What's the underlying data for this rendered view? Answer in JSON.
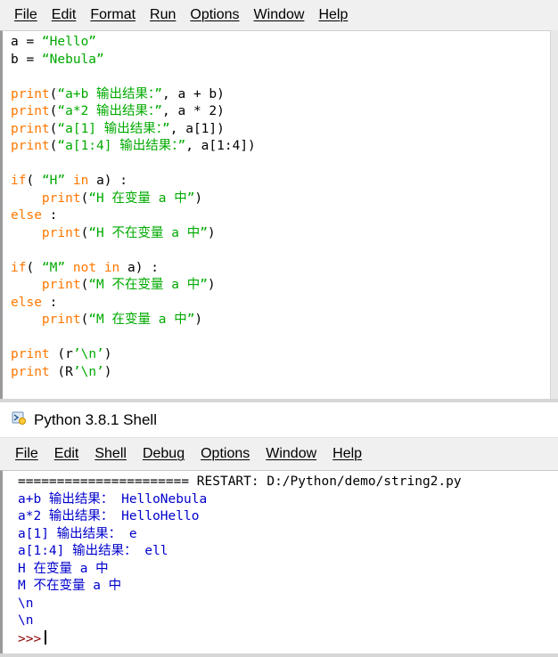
{
  "editor": {
    "menu": [
      "File",
      "Edit",
      "Format",
      "Run",
      "Options",
      "Window",
      "Help"
    ],
    "lines": [
      "a = “Hello”",
      "b = “Nebula”",
      "",
      "print(“a+b 输出结果：”, a + b)",
      "print(“a*2 输出结果：”, a * 2)",
      "print(“a[1] 输出结果：”, a[1])",
      "print(“a[1:4] 输出结果：”, a[1:4])",
      "",
      "if( “H” in a) :",
      "    print(“H 在变量 a 中”)",
      "else :",
      "    print(“H 不在变量 a 中”)",
      "",
      "if( “M” not in a) :",
      "    print(“M 不在变量 a 中”)",
      "else :",
      "    print(“M 在变量 a 中”)",
      "",
      "print (r’\\n’)",
      "print (R’\\n’)"
    ]
  },
  "shell": {
    "title": "Python 3.8.1 Shell",
    "menu": [
      "File",
      "Edit",
      "Shell",
      "Debug",
      "Options",
      "Window",
      "Help"
    ],
    "restart_line": "====================== RESTART: D:/Python/demo/string2.py",
    "output_lines": [
      "a+b 输出结果： HelloNebula",
      "a*2 输出结果： HelloHello",
      "a[1] 输出结果： e",
      "a[1:4] 输出结果： ell",
      "H 在变量 a 中",
      "M 不在变量 a 中",
      "\\n",
      "\\n"
    ],
    "prompt": ">>>"
  },
  "colors": {
    "keyword": "#ff7700",
    "string": "#00aa00",
    "output": "#0000cc",
    "prompt": "#8b0000"
  }
}
